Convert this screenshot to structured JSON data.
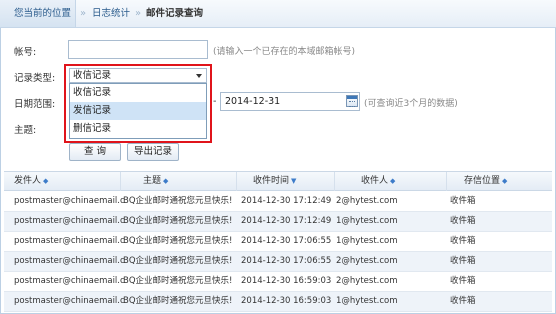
{
  "breadcrumb": {
    "location": "您当前的位置",
    "parent": "日志统计",
    "separator": "»",
    "current": "邮件记录查询"
  },
  "form": {
    "account_label": "帐号:",
    "account_value": "",
    "account_hint": "(请输入一个已存在的本域邮箱帐号)",
    "type_label": "记录类型:",
    "type_selected": "收信记录",
    "type_options": [
      "收信记录",
      "发信记录",
      "删信记录"
    ],
    "date_label": "日期范围:",
    "date_dash": "-",
    "date_end": "2014-12-31",
    "date_hint": "(可查询近3个月的数据)",
    "subject_label": "主题:",
    "query_button": "查 询",
    "export_button": "导出记录"
  },
  "colors": {
    "highlight_border": "#e0141b",
    "sort_arrow": "#3d7cc9",
    "breadcrumb_text": "#2a5b8c"
  },
  "table": {
    "sort_icon": "◆",
    "sort_active_icon": "▼",
    "columns": [
      "发件人",
      "主题",
      "收件时间",
      "收件人",
      "存信位置"
    ],
    "rows": [
      [
        "postmaster@chinaemail.cn",
        "BQ企业邮时通祝您元旦快乐!",
        "2014-12-30 17:12:49",
        "2@hytest.com",
        "收件箱"
      ],
      [
        "postmaster@chinaemail.cn",
        "BQ企业邮时通祝您元旦快乐!",
        "2014-12-30 17:12:49",
        "1@hytest.com",
        "收件箱"
      ],
      [
        "postmaster@chinaemail.cn",
        "BQ企业邮时通祝您元旦快乐!",
        "2014-12-30 17:06:55",
        "1@hytest.com",
        "收件箱"
      ],
      [
        "postmaster@chinaemail.cn",
        "BQ企业邮时通祝您元旦快乐!",
        "2014-12-30 17:06:55",
        "2@hytest.com",
        "收件箱"
      ],
      [
        "postmaster@chinaemail.cn",
        "BQ企业邮时通祝您元旦快乐!",
        "2014-12-30 16:59:03",
        "2@hytest.com",
        "收件箱"
      ],
      [
        "postmaster@chinaemail.cn",
        "BQ企业邮时通祝您元旦快乐!",
        "2014-12-30 16:59:03",
        "1@hytest.com",
        "收件箱"
      ]
    ]
  }
}
